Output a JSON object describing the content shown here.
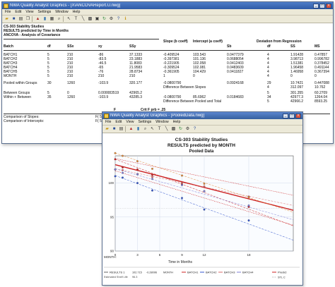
{
  "window1": {
    "title": "NWA Quality Analyst Graphics - [X\\ANCOVAReport.U.nwg]",
    "menu": [
      "File",
      "Edit",
      "View",
      "Settings",
      "Window",
      "Help"
    ],
    "report": {
      "titles": [
        "CS-303 Stability Studies",
        "RESULTS predicted by Time in Months",
        "ANCOVA - Analysis of Covariance"
      ],
      "headers": [
        "Batch",
        "df",
        "SSx",
        "xy",
        "SSy",
        "Slope (b coeff)",
        "Intercept (a coeff)",
        "Sb",
        "Deviation from Regression",
        "df",
        "SS",
        "MS"
      ],
      "rows": [
        {
          "batch": "BATCH1",
          "df": "5",
          "ssx": "210",
          "xy": "-86",
          "ssy": "37.1333",
          "slope": "-0.409524",
          "intercept": "103.543",
          "sb": "0.0477379",
          "d_df": "4",
          "d_ss": "1.91428",
          "d_ms": "0.47857"
        },
        {
          "batch": "BATCH2",
          "df": "5",
          "ssx": "210",
          "xy": "-83.5",
          "ssy": "23.1883",
          "slope": "-0.397381",
          "intercept": "101.136",
          "sb": "0.0688054",
          "d_df": "4",
          "d_ss": "3.98713",
          "d_ms": "0.996782"
        },
        {
          "batch": "BATCH3",
          "df": "5",
          "ssx": "210",
          "xy": "-46.5",
          "ssy": "11.8083",
          "slope": "-0.221905",
          "intercept": "102.058",
          "sb": "0.0412403",
          "d_df": "4",
          "d_ss": "1.51381",
          "d_ms": "0.378452"
        },
        {
          "batch": "BATCH4",
          "df": "5",
          "ssx": "210",
          "xy": "-65",
          "ssy": "21.9583",
          "slope": "-0.309524",
          "intercept": "102.081",
          "sb": "0.0483609",
          "d_df": "4",
          "d_ss": "1.96458",
          "d_ms": "0.491144"
        },
        {
          "batch": "BATCH5",
          "df": "5",
          "ssx": "210",
          "xy": "-76",
          "ssy": "28.8734",
          "slope": "-0.361905",
          "intercept": "104.429",
          "sb": "0.0411827",
          "d_df": "4",
          "d_ss": "1.46958",
          "d_ms": "0.367394"
        },
        {
          "batch": "MONTH",
          "df": "5",
          "ssx": "210",
          "xy": "210",
          "ssy": "210",
          "slope": "1",
          "intercept": "0",
          "sb": "",
          "d_df": "4",
          "d_ss": "0",
          "d_ms": "0"
        }
      ],
      "pooled": {
        "label": "Pooled within Groups",
        "df": "30",
        "ssx": "1260",
        "xy": "-103.9",
        "ssy": "320.177",
        "slope": "-0.0800790",
        "intercept": "",
        "sb": "0.0924168",
        "d_df": "29",
        "d_ss": "10.7421",
        "d_ms": "0.447088"
      },
      "diff_slopes": {
        "label": "Difference Between Slopes",
        "d_df": "4",
        "d_ss": "312.097",
        "d_ms": "10.762"
      },
      "between": {
        "label": "Between Groups",
        "df": "5",
        "ssx": "0",
        "xy": "0.000083519",
        "ssy": "42965.2",
        "d_df": "5",
        "d_ss": "301.355",
        "d_ms": "60.2709"
      },
      "within_between": {
        "label": "Within + Between",
        "df": "35",
        "ssx": "1260",
        "xy": "-103.9",
        "ssy": "43285.3",
        "slope": "-0.0800790",
        "intercept": "85.6962",
        "sb": "0.0184683",
        "d_df": "34",
        "d_ss": "42977.3",
        "d_ms": "1264.04"
      },
      "diff_pooled_total": {
        "label": "Difference Between Pooled and Total",
        "d_df": "5",
        "d_ss": "42966.2",
        "d_ms": "8593.25"
      },
      "f_line": {
        "f": "F",
        "critf": "Crit F prb = .25"
      },
      "comparison": [
        "Comparison of Slopes:",
        "Comparison of Intercepts:"
      ],
      "footer_right": [
        "F( 5, 30 )",
        "F( 5, 34 )"
      ]
    }
  },
  "window2": {
    "title": "NWA Quality Analyst Graphics - [PooledData.nwg]",
    "menu": [
      "File",
      "Edit",
      "View",
      "Settings",
      "Window",
      "Help"
    ],
    "chart_titles": [
      "CS-303 Stability Studies",
      "RESULTS predicted by MONTH",
      "Pooled Data"
    ],
    "xlabel": "Time in Months",
    "x_axis_label": "MONTH:",
    "legend": [
      {
        "name": "RESULTS 1",
        "color": "#666666"
      },
      {
        "name": "BATCH1",
        "color": "#cc2020"
      },
      {
        "name": "BATCH2",
        "color": "#3355cc"
      },
      {
        "name": "BATCH3",
        "color": "#d86a6a"
      },
      {
        "name": "BATCH4",
        "color": "#7d7dd6"
      },
      {
        "name": "Predict",
        "color": "#cc2020"
      }
    ],
    "legend_sub": [
      "Estimated Shelf Life",
      "102.715",
      "-0.28096",
      "MONTH"
    ],
    "legend_extra": [
      "96.3",
      "STL C"
    ]
  },
  "chart_data": {
    "type": "scatter",
    "title": "CS-303 Stability Studies",
    "subtitle": "RESULTS predicted by MONTH",
    "xlabel": "Time in Months",
    "ylabel": "",
    "xlim": [
      0,
      24
    ],
    "ylim": [
      90,
      104
    ],
    "xticks": [
      0,
      3,
      6,
      9,
      12,
      18
    ],
    "yticks": [
      90,
      95,
      100
    ],
    "series": [
      {
        "name": "BATCH1",
        "color": "#cc2020",
        "x": [
          0,
          1,
          3,
          5,
          9,
          12,
          18
        ],
        "y": [
          103.5,
          102.3,
          102,
          101.2,
          99.8,
          98.8,
          96.5
        ]
      },
      {
        "name": "BATCH2",
        "color": "#3355cc",
        "x": [
          0,
          1,
          3,
          5,
          9,
          12,
          18
        ],
        "y": [
          101,
          100.8,
          100,
          98.9,
          97.8,
          96.1,
          94.5
        ]
      },
      {
        "name": "BATCH3",
        "color": "#d86a6a",
        "x": [
          0,
          1,
          3,
          5,
          9,
          12,
          18
        ],
        "y": [
          102,
          101.9,
          101.3,
          100.9,
          100,
          99.5,
          98
        ]
      },
      {
        "name": "BATCH4",
        "color": "#7d7dd6",
        "x": [
          0,
          1,
          3,
          5,
          9,
          12,
          18
        ],
        "y": [
          102,
          101.5,
          101.3,
          100.6,
          99.7,
          98.8,
          96.7
        ]
      },
      {
        "name": "BATCH5",
        "color": "#e08a3a",
        "x": [
          0,
          1,
          3,
          5,
          9,
          12,
          18
        ],
        "y": [
          104.4,
          104,
          103.2,
          102.1,
          101.1,
          99.9,
          97.9
        ]
      }
    ],
    "lines": [
      {
        "name": "Predict",
        "color": "#cc2020",
        "x": [
          0,
          24
        ],
        "y": [
          102.7,
          96
        ]
      },
      {
        "name": "BATCH1",
        "color": "#cc2020",
        "x": [
          0,
          24
        ],
        "y": [
          103.5,
          93.7
        ]
      },
      {
        "name": "BATCH2",
        "color": "#3355cc",
        "x": [
          0,
          24
        ],
        "y": [
          101.1,
          91.6
        ]
      },
      {
        "name": "BATCH3",
        "color": "#d86a6a",
        "x": [
          0,
          24
        ],
        "y": [
          102.1,
          96.7
        ]
      },
      {
        "name": "BATCH4",
        "color": "#7d7dd6",
        "x": [
          0,
          24
        ],
        "y": [
          102.1,
          94.6
        ]
      },
      {
        "name": "BATCH5",
        "color": "#e08a3a",
        "x": [
          0,
          24
        ],
        "y": [
          104.4,
          95.7
        ]
      }
    ]
  }
}
